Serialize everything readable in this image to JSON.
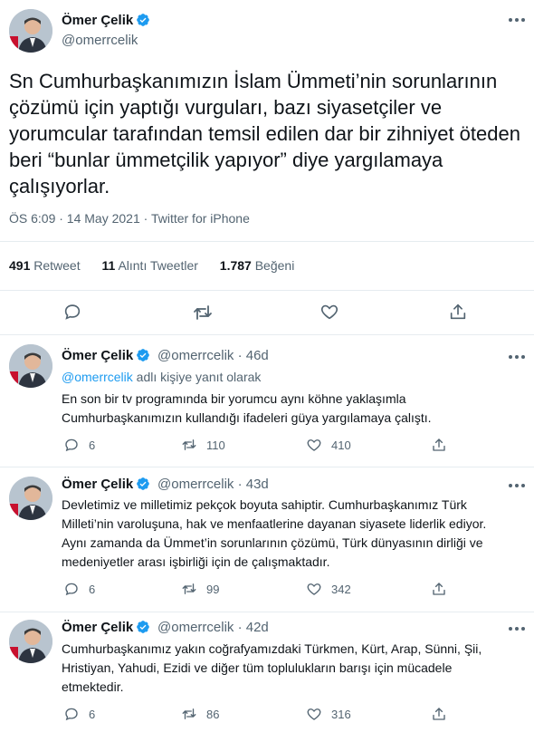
{
  "main_tweet": {
    "author_name": "Ömer Çelik",
    "author_handle": "@omerrcelik",
    "text": "Sn Cumhurbaşkanımızın İslam Ümmeti’nin sorunlarının çözümü için yaptığı vurguları, bazı siyasetçiler ve yorumcular tarafından temsil edilen dar bir zihniyet öteden beri “bunlar ümmetçilik yapıyor” diye yargılamaya çalışıyorlar.",
    "meta": "ÖS 6:09 · 14 May 2021 · Twitter for iPhone",
    "stats": {
      "retweets_count": "491",
      "retweets_label": "Retweet",
      "quotes_count": "11",
      "quotes_label": "Alıntı Tweetler",
      "likes_count": "1.787",
      "likes_label": "Beğeni"
    }
  },
  "replies": [
    {
      "name": "Ömer Çelik",
      "handle": "@omerrcelik · 46d",
      "replying_mention": "@omerrcelik",
      "replying_suffix": " adlı kişiye yanıt olarak",
      "text": "En son bir tv programında bir yorumcu aynı köhne yaklaşımla Cumhurbaşkanımızın kullandığı ifadeleri güya yargılamaya çalıştı.",
      "replies": "6",
      "retweets": "110",
      "likes": "410"
    },
    {
      "name": "Ömer Çelik",
      "handle": "@omerrcelik · 43d",
      "text": "Devletimiz ve milletimiz  pekçok boyuta sahiptir. Cumhurbaşkanımız Türk Milleti’nin varoluşuna, hak ve menfaatlerine dayanan siyasete liderlik ediyor. Aynı zamanda da Ümmet’in sorunlarının çözümü, Türk dünyasının dirliği ve medeniyetler arası işbirliği için de çalışmaktadır.",
      "replies": "6",
      "retweets": "99",
      "likes": "342"
    },
    {
      "name": "Ömer Çelik",
      "handle": "@omerrcelik · 42d",
      "text": "Cumhurbaşkanımız yakın coğrafyamızdaki Türkmen, Kürt, Arap, Sünni, Şii, Hristiyan, Yahudi, Ezidi ve diğer tüm toplulukların barışı için mücadele etmektedir.",
      "replies": "6",
      "retweets": "86",
      "likes": "316"
    }
  ],
  "icons": [
    "verified-icon",
    "more-icon",
    "reply-icon",
    "retweet-icon",
    "like-icon",
    "share-icon"
  ],
  "colors": {
    "accent": "#1d9bf0",
    "muted": "#536471",
    "text": "#0f1419",
    "divider": "#e6ecf0"
  }
}
